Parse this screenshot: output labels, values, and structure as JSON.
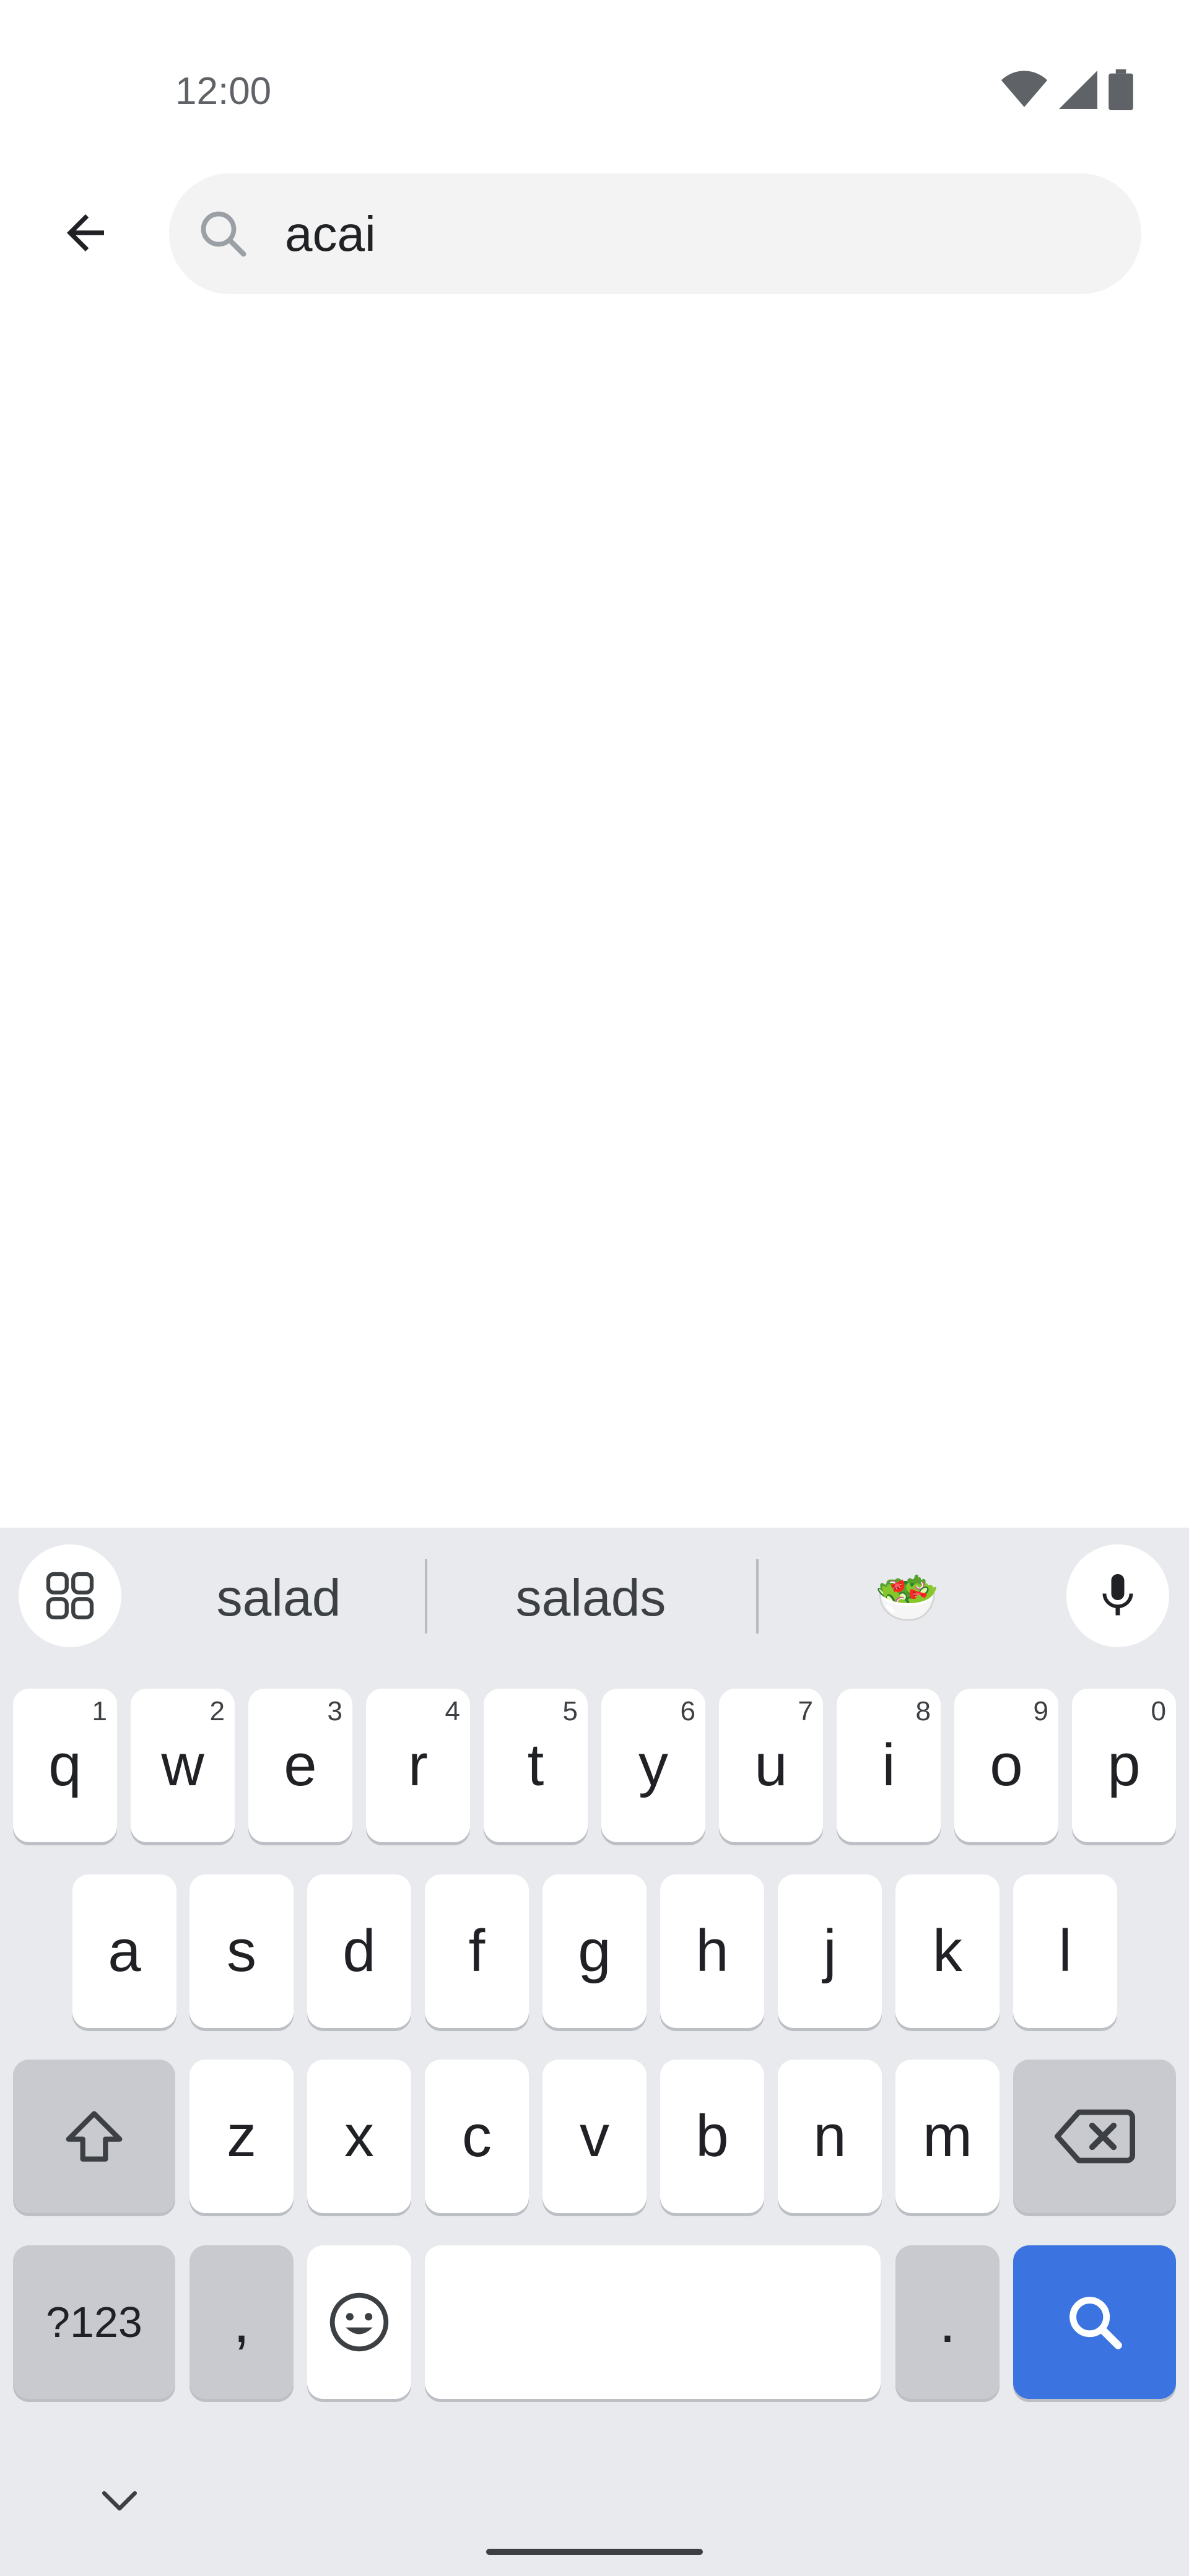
{
  "status_bar": {
    "time": "12:00"
  },
  "search": {
    "value": "acai"
  },
  "keyboard": {
    "suggestions": [
      "salad",
      "salads",
      "🥗"
    ],
    "row1": [
      {
        "label": "q",
        "hint": "1"
      },
      {
        "label": "w",
        "hint": "2"
      },
      {
        "label": "e",
        "hint": "3"
      },
      {
        "label": "r",
        "hint": "4"
      },
      {
        "label": "t",
        "hint": "5"
      },
      {
        "label": "y",
        "hint": "6"
      },
      {
        "label": "u",
        "hint": "7"
      },
      {
        "label": "i",
        "hint": "8"
      },
      {
        "label": "o",
        "hint": "9"
      },
      {
        "label": "p",
        "hint": "0"
      }
    ],
    "row2": [
      "a",
      "s",
      "d",
      "f",
      "g",
      "h",
      "j",
      "k",
      "l"
    ],
    "row3": [
      "z",
      "x",
      "c",
      "v",
      "b",
      "n",
      "m"
    ],
    "symbols_label": "?123",
    "comma_label": ",",
    "period_label": ".",
    "colors": {
      "action": "#3b73e0",
      "background": "#e8eaed"
    }
  }
}
